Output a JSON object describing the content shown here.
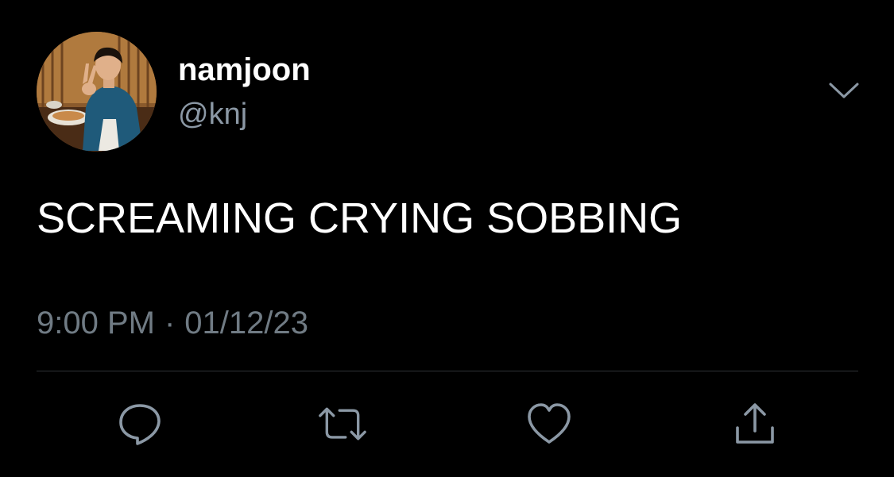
{
  "user": {
    "display_name": "namjoon",
    "handle": "@knj",
    "avatar_icon": "profile-photo"
  },
  "tweet": {
    "text": "SCREAMING CRYING SOBBING",
    "time": "9:00 PM",
    "separator": "·",
    "date": "01/12/23"
  },
  "actions": [
    {
      "name": "reply",
      "icon": "speech-bubble-icon"
    },
    {
      "name": "retweet",
      "icon": "retweet-arrows-icon"
    },
    {
      "name": "like",
      "icon": "heart-icon"
    },
    {
      "name": "share",
      "icon": "share-upload-icon"
    }
  ],
  "menu": {
    "icon": "chevron-down-icon"
  },
  "colors": {
    "background": "#000000",
    "text_primary": "#ffffff",
    "text_secondary": "#8b98a5",
    "icon": "#8b98a5",
    "divider": "#2f3336"
  }
}
